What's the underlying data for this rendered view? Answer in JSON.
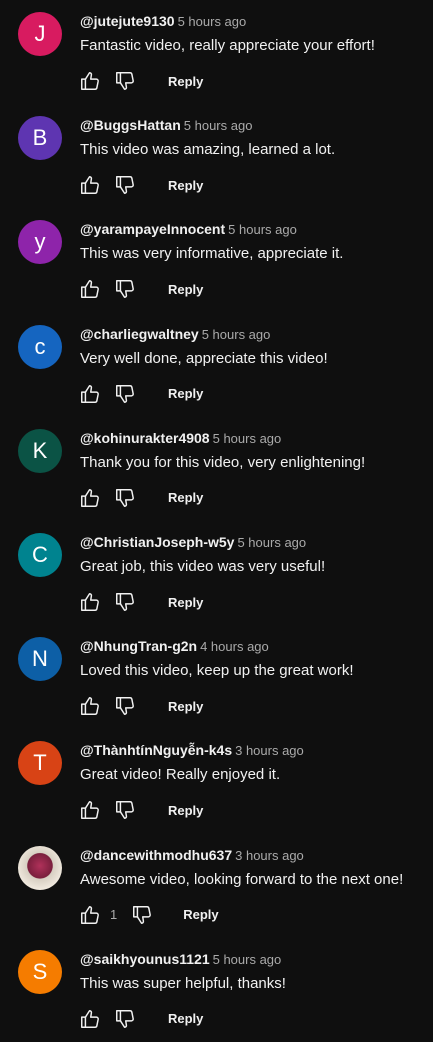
{
  "icons": {
    "like": "thumb-up-icon",
    "dislike": "thumb-down-icon"
  },
  "comments": [
    {
      "initial": "J",
      "color": "#d81b60",
      "handle": "@jutejute9130",
      "time": "5 hours ago",
      "text": "Fantastic video, really appreciate your effort!",
      "reply_label": "Reply"
    },
    {
      "initial": "B",
      "color": "#5e35b1",
      "handle": "@BuggsHattan",
      "time": "5 hours ago",
      "text": "This video was amazing, learned a lot.",
      "reply_label": "Reply"
    },
    {
      "initial": "y",
      "color": "#8e24aa",
      "handle": "@yarampayeInnocent",
      "time": "5 hours ago",
      "text": "This was very informative, appreciate it.",
      "reply_label": "Reply"
    },
    {
      "initial": "c",
      "color": "#1565c0",
      "handle": "@charliegwaltney",
      "time": "5 hours ago",
      "text": "Very well done, appreciate this video!",
      "reply_label": "Reply"
    },
    {
      "initial": "K",
      "color": "#0b5345",
      "handle": "@kohinurakter4908",
      "time": "5 hours ago",
      "text": "Thank you for this video, very enlightening!",
      "reply_label": "Reply"
    },
    {
      "initial": "C",
      "color": "#00838f",
      "handle": "@ChristianJoseph-w5y",
      "time": "5 hours ago",
      "text": "Great job, this video was very useful!",
      "reply_label": "Reply"
    },
    {
      "initial": "N",
      "color": "#0d5fa6",
      "handle": "@NhungTran-g2n",
      "time": "4 hours ago",
      "text": "Loved this video, keep up the great work!",
      "reply_label": "Reply"
    },
    {
      "initial": "T",
      "color": "#d84315",
      "handle": "@ThànhtínNguyễn-k4s",
      "time": "3 hours ago",
      "text": "Great video! Really enjoyed it.",
      "reply_label": "Reply"
    },
    {
      "initial": "",
      "color": "",
      "photo": true,
      "handle": "@dancewithmodhu637",
      "time": "3 hours ago",
      "text": "Awesome video, looking forward to the next one!",
      "like_count": "1",
      "reply_label": "Reply"
    },
    {
      "initial": "S",
      "color": "#f57c00",
      "handle": "@saikhyounus1121",
      "time": "5 hours ago",
      "text": "This was super helpful, thanks!",
      "reply_label": "Reply"
    }
  ]
}
